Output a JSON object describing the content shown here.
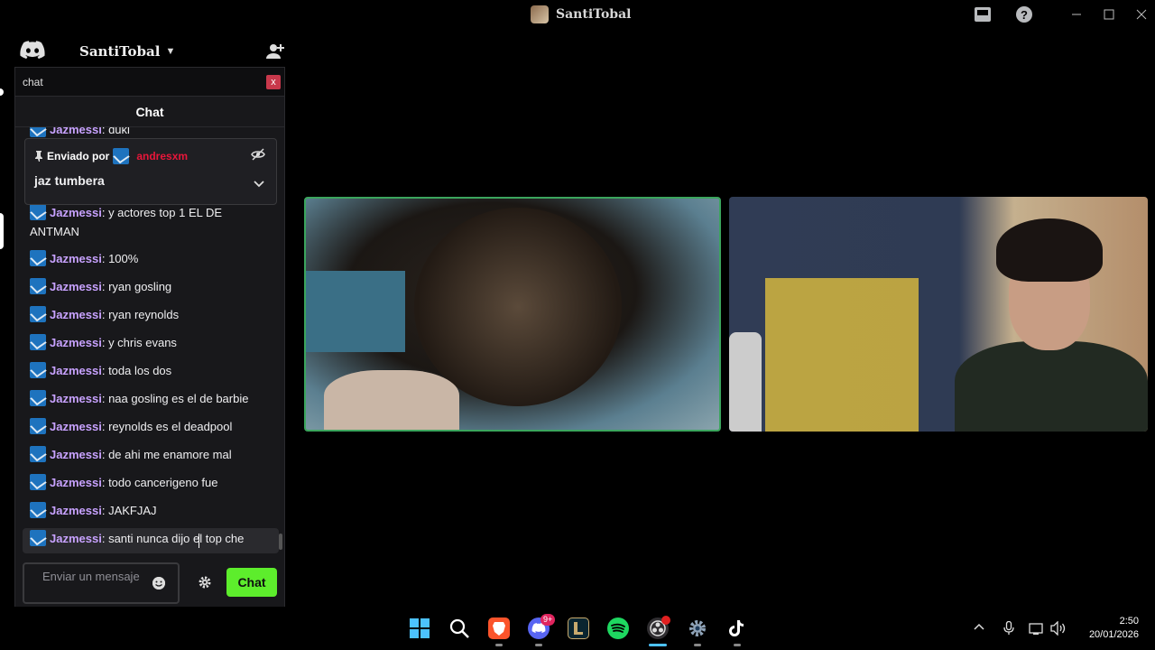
{
  "window": {
    "title": "SantiTobal"
  },
  "server": {
    "name": "SantiTobal"
  },
  "panel": {
    "search_value": "chat",
    "close_label": "x",
    "header": "Chat"
  },
  "pinned": {
    "label": "Enviado por",
    "sender": "andresxm",
    "text": "jaz tumbera"
  },
  "messages": [
    {
      "user": "Jazmessi",
      "text": "duki"
    },
    {
      "user": "Jazmessi",
      "text": "y actores top 1 EL DE ANTMAN"
    },
    {
      "user": "Jazmessi",
      "text": "100%"
    },
    {
      "user": "Jazmessi",
      "text": "ryan gosling"
    },
    {
      "user": "Jazmessi",
      "text": "ryan reynolds"
    },
    {
      "user": "Jazmessi",
      "text": "y chris evans"
    },
    {
      "user": "Jazmessi",
      "text": "toda los dos"
    },
    {
      "user": "Jazmessi",
      "text": "naa gosling es el de barbie"
    },
    {
      "user": "Jazmessi",
      "text": "reynolds es el deadpool"
    },
    {
      "user": "Jazmessi",
      "text": "de ahi me enamore mal"
    },
    {
      "user": "Jazmessi",
      "text": "todo cancerigeno fue"
    },
    {
      "user": "Jazmessi",
      "text": "JAKFJAJ"
    },
    {
      "user": "Jazmessi",
      "text": "santi nunca dijo el top che"
    }
  ],
  "composer": {
    "placeholder": "Enviar un mensaje",
    "send_label": "Chat"
  },
  "taskbar": {
    "apps": [
      "start-icon",
      "search-icon",
      "brave-icon",
      "discord-icon",
      "league-icon",
      "spotify-icon",
      "obs-icon",
      "settings-icon",
      "tiktok-icon"
    ],
    "discord_badge": "9+",
    "time": "2:50",
    "date": "20/01/2026"
  },
  "colors": {
    "accent_green": "#5ded2c",
    "speaking_border": "#3ba55d",
    "username": "#c8a2ff",
    "pin_sender": "#e8163a",
    "badge_blue": "#1e73be"
  }
}
